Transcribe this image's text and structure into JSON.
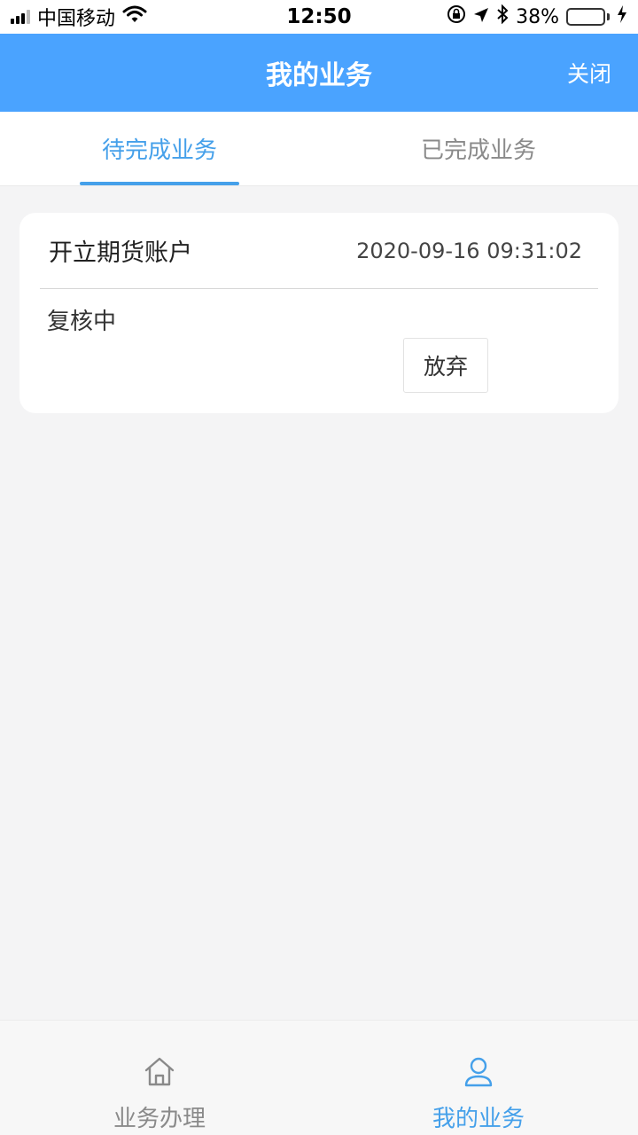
{
  "colors": {
    "primary": "#4aa3ff",
    "tab_active": "#45a0ea",
    "tab_inactive": "#8a8a8a",
    "battery_fill": "#4cd964"
  },
  "status_bar": {
    "carrier": "中国移动",
    "time": "12:50",
    "battery_percent": "38%",
    "battery_level": 0.38,
    "icons": [
      "signal-icon",
      "wifi-icon",
      "orientation-lock-icon",
      "location-icon",
      "bluetooth-icon",
      "battery-icon",
      "charging-icon"
    ]
  },
  "nav": {
    "title": "我的业务",
    "close_label": "关闭"
  },
  "tabs": [
    {
      "label": "待完成业务",
      "active": true
    },
    {
      "label": "已完成业务",
      "active": false
    }
  ],
  "business_items": [
    {
      "title": "开立期货账户",
      "time": "2020-09-16 09:31:02",
      "status": "复核中",
      "action_label": "放弃"
    }
  ],
  "tabbar": {
    "items": [
      {
        "label": "业务办理",
        "icon": "home-icon",
        "active": false
      },
      {
        "label": "我的业务",
        "icon": "user-icon",
        "active": true
      }
    ]
  }
}
